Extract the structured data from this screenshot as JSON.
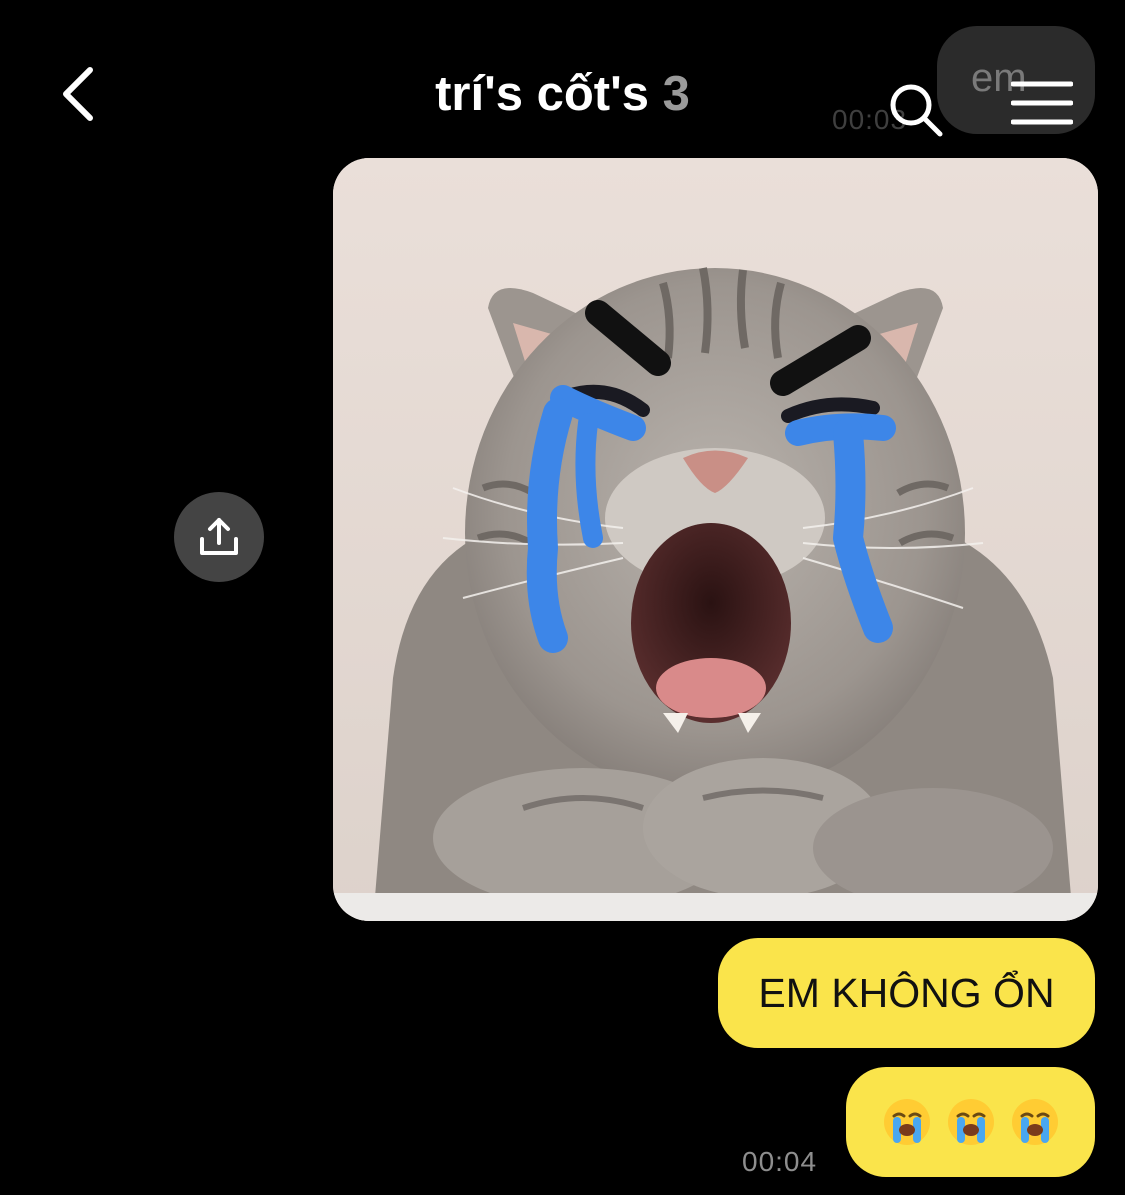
{
  "header": {
    "title": "trí's cốt's",
    "member_count": "3",
    "back_icon": "chevron-left-icon",
    "search_icon": "search-icon",
    "menu_icon": "hamburger-menu-icon"
  },
  "previous_message": {
    "text": "em",
    "time": "00:03"
  },
  "share": {
    "icon": "share-upload-icon"
  },
  "messages": [
    {
      "type": "image",
      "description_icon": "crying-cat-image"
    },
    {
      "type": "text",
      "text": "EM KHÔNG ỔN"
    },
    {
      "type": "emoji",
      "text": "😭😭😭"
    }
  ],
  "last_time": "00:04",
  "colors": {
    "bubble_yellow": "#fae44b",
    "background": "#000000",
    "share_button": "#444444",
    "tear_blue": "#3d86e8"
  }
}
